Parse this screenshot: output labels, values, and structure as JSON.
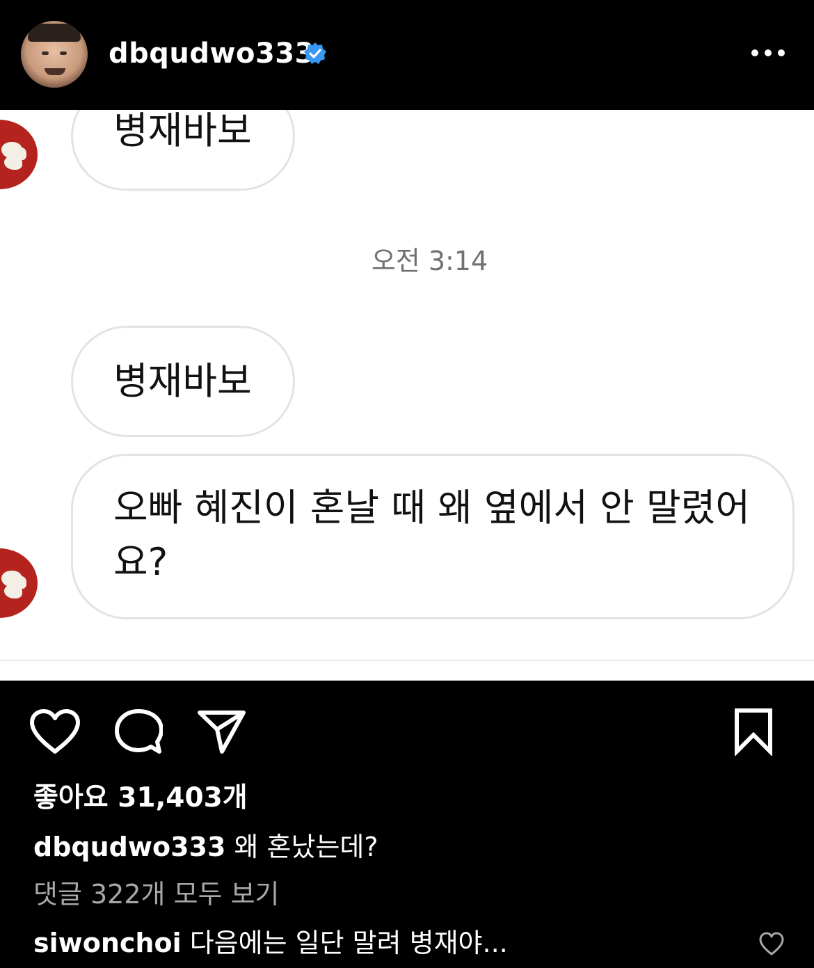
{
  "header": {
    "username": "dbqudwo333",
    "verified": true,
    "more_icon": "more-horizontal-icon"
  },
  "chat": {
    "messages_before": [
      {
        "text": "병재바보"
      }
    ],
    "timestamp": "오전 3:14",
    "messages_after": [
      {
        "text": "병재바보"
      },
      {
        "text": "오빠 혜진이 혼날 때 왜 옆에서 안 말렸어\n요?"
      }
    ],
    "colors": {
      "bubble_border": "#e3e3e3",
      "avatar_red": "#b5231e"
    }
  },
  "actions": {
    "like_icon": "heart-icon",
    "comment_icon": "comment-icon",
    "share_icon": "send-icon",
    "save_icon": "bookmark-icon"
  },
  "post": {
    "likes": "좋아요 31,403개",
    "caption_user": "dbqudwo333",
    "caption_text": "왜 혼났는데?",
    "view_comments": "댓글 322개 모두 보기",
    "comment_user": "siwonchoi",
    "comment_text": "다음에는 일단 말려 병재야..."
  }
}
